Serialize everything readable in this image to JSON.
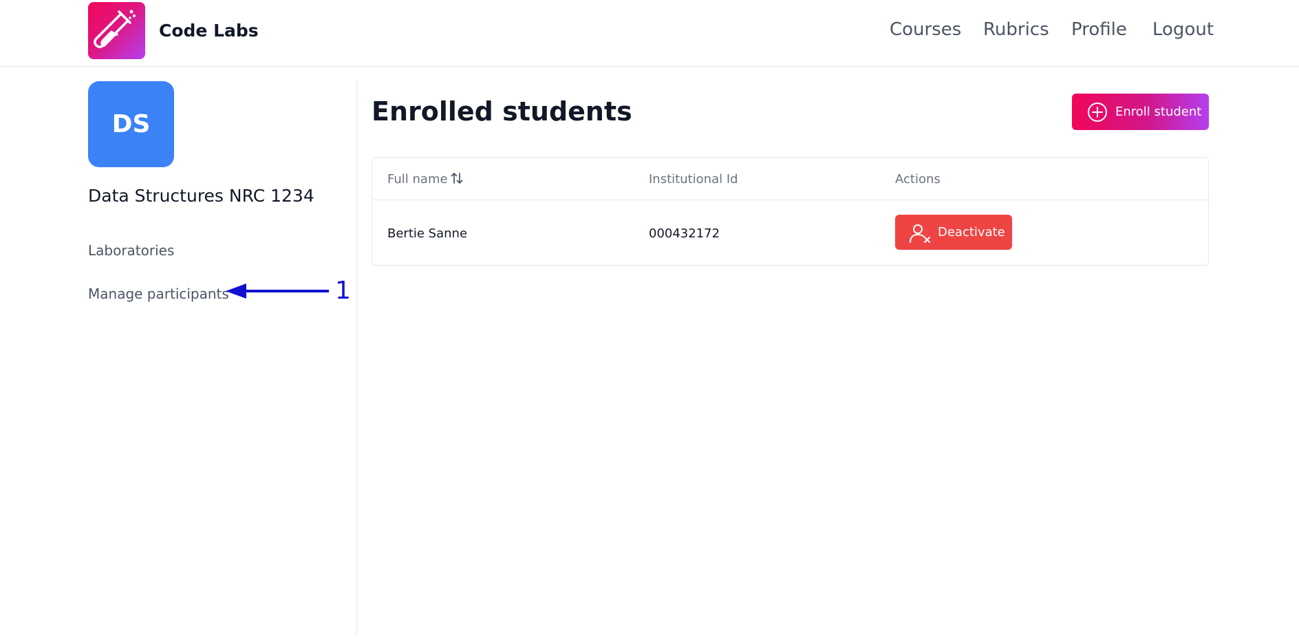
{
  "header": {
    "brand": "Code Labs",
    "nav": [
      {
        "label": "Courses"
      },
      {
        "label": "Rubrics"
      },
      {
        "label": "Profile"
      },
      {
        "label": "Logout"
      }
    ]
  },
  "sidebar": {
    "avatar_initials": "DS",
    "course_title": "Data Structures NRC 1234",
    "items": [
      {
        "label": "Laboratories"
      },
      {
        "label": "Manage participants"
      }
    ],
    "annotation_number": "1"
  },
  "main": {
    "title": "Enrolled students",
    "enroll_button": "Enroll student",
    "table": {
      "columns": [
        "Full name",
        "Institutional Id",
        "Actions"
      ],
      "rows": [
        {
          "full_name": "Bertie Sanne",
          "institutional_id": "000432172",
          "action": "Deactivate"
        }
      ]
    }
  },
  "colors": {
    "brand_gradient_start": "#f0075a",
    "brand_gradient_end": "#b43ff0",
    "avatar": "#3b82f6",
    "danger": "#ef4444",
    "annotation": "#1010d0"
  },
  "icons": [
    "test-tube-icon",
    "plus-circle-icon",
    "sort-arrows-icon",
    "user-x-icon",
    "annotation-arrow-icon"
  ]
}
